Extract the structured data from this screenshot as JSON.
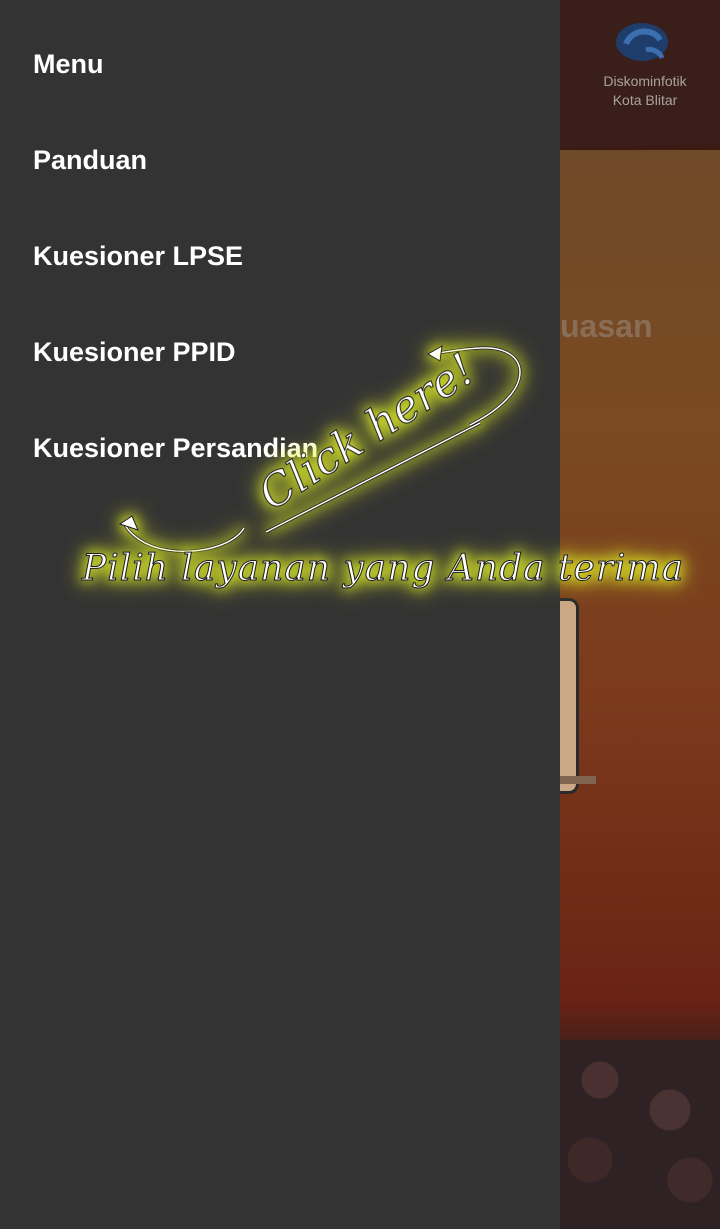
{
  "background": {
    "brand_line1": "Diskominfotik",
    "brand_line2": "Kota Blitar",
    "partial_heading": "uasan"
  },
  "drawer": {
    "items": [
      {
        "label": "Menu"
      },
      {
        "label": "Panduan"
      },
      {
        "label": "Kuesioner LPSE"
      },
      {
        "label": "Kuesioner PPID"
      },
      {
        "label": "Kuesioner Persandian"
      }
    ]
  },
  "overlay": {
    "click_hint": "Click here!",
    "instruction": "Pilih layanan yang Anda terima"
  },
  "colors": {
    "drawer_bg": "#333333",
    "menu_text": "#ffffff",
    "hint_glow": "#f4ff2e"
  }
}
